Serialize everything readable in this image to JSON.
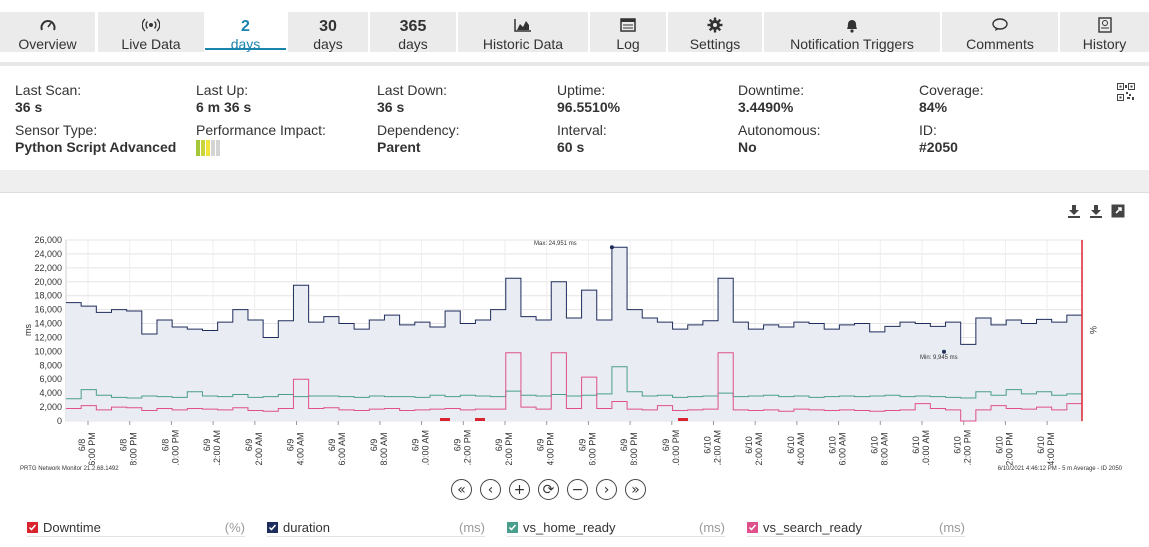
{
  "tabs": [
    {
      "label": "Overview",
      "icon": "gauge-icon"
    },
    {
      "label": "Live Data",
      "icon": "broadcast-icon"
    },
    {
      "big": "2",
      "label": "days",
      "selected": true
    },
    {
      "big": "30",
      "label": "days"
    },
    {
      "big": "365",
      "label": "days"
    },
    {
      "label": "Historic Data",
      "icon": "area-chart-icon"
    },
    {
      "label": "Log",
      "icon": "list-icon"
    },
    {
      "label": "Settings",
      "icon": "gear-icon"
    },
    {
      "label": "Notification Triggers",
      "icon": "bell-icon"
    },
    {
      "label": "Comments",
      "icon": "comment-icon"
    },
    {
      "label": "History",
      "icon": "history-icon"
    }
  ],
  "info": {
    "last_scan": {
      "label": "Last Scan:",
      "value": "36 s"
    },
    "last_up": {
      "label": "Last Up:",
      "value": "6 m 36 s"
    },
    "last_down": {
      "label": "Last Down:",
      "value": "36 s"
    },
    "uptime": {
      "label": "Uptime:",
      "value": "96.5510%"
    },
    "downtime": {
      "label": "Downtime:",
      "value": "3.4490%"
    },
    "coverage": {
      "label": "Coverage:",
      "value": "84%"
    },
    "sensor_type": {
      "label": "Sensor Type:",
      "value": "Python Script Advanced"
    },
    "performance_impact": {
      "label": "Performance Impact:",
      "level": 3,
      "of": 5
    },
    "dependency": {
      "label": "Dependency:",
      "value": "Parent"
    },
    "interval": {
      "label": "Interval:",
      "value": "60 s"
    },
    "autonomous": {
      "label": "Autonomous:",
      "value": "No"
    },
    "id": {
      "label": "ID:",
      "value": "#2050"
    }
  },
  "chart_data": {
    "type": "line",
    "ylabel_left": "ms",
    "ylabel_right": "%",
    "y_ticks": [
      "26,000",
      "24,000",
      "22,000",
      "20,000",
      "18,000",
      "16,000",
      "14,000",
      "12,000",
      "10,000",
      "8,000",
      "6,000",
      "4,000",
      "2,000",
      "0"
    ],
    "ylim": [
      0,
      26000
    ],
    "x_ticks": [
      [
        "6/8",
        "6:00 PM"
      ],
      [
        "6/8",
        "8:00 PM"
      ],
      [
        "6/8",
        "10:00 PM"
      ],
      [
        "6/9",
        "12:00 AM"
      ],
      [
        "6/9",
        "2:00 AM"
      ],
      [
        "6/9",
        "4:00 AM"
      ],
      [
        "6/9",
        "6:00 AM"
      ],
      [
        "6/9",
        "8:00 AM"
      ],
      [
        "6/9",
        "10:00 AM"
      ],
      [
        "6/9",
        "12:00 PM"
      ],
      [
        "6/9",
        "2:00 PM"
      ],
      [
        "6/9",
        "4:00 PM"
      ],
      [
        "6/9",
        "6:00 PM"
      ],
      [
        "6/9",
        "8:00 PM"
      ],
      [
        "6/9",
        "10:00 PM"
      ],
      [
        "6/10",
        "12:00 AM"
      ],
      [
        "6/10",
        "2:00 AM"
      ],
      [
        "6/10",
        "4:00 AM"
      ],
      [
        "6/10",
        "6:00 AM"
      ],
      [
        "6/10",
        "8:00 AM"
      ],
      [
        "6/10",
        "10:00 AM"
      ],
      [
        "6/10",
        "12:00 PM"
      ],
      [
        "6/10",
        "2:00 PM"
      ],
      [
        "6/10",
        "4:00 PM"
      ]
    ],
    "annotations": {
      "max": "Max: 24,951 ms",
      "min": "Min: 9,945 ms"
    },
    "series": [
      {
        "name": "duration",
        "color": "#1f2d5c",
        "values": [
          17000,
          16500,
          15600,
          16000,
          15800,
          12500,
          14500,
          13500,
          13200,
          13000,
          14200,
          16000,
          14500,
          12000,
          14400,
          19500,
          14200,
          15000,
          14000,
          13200,
          14500,
          15200,
          13800,
          14200,
          13500,
          15800,
          14000,
          14500,
          16000,
          20500,
          15000,
          14500,
          20000,
          14800,
          18800,
          14500,
          24951,
          16000,
          14800,
          14200,
          13200,
          13800,
          14400,
          20500,
          14200,
          13200,
          13800,
          13500,
          14200,
          14000,
          13200,
          13800,
          14000,
          12800,
          13600,
          14200,
          14000,
          13600,
          14200,
          11000,
          14800,
          13800,
          14500,
          14000,
          14600,
          14200,
          15200,
          15000
        ]
      },
      {
        "name": "vs_home_ready",
        "color": "#4a9f8c",
        "values": [
          3200,
          4500,
          3700,
          3400,
          3300,
          3600,
          3500,
          3400,
          4200,
          3600,
          3500,
          3800,
          3400,
          3500,
          3800,
          3500,
          3600,
          3600,
          3500,
          3400,
          3600,
          3500,
          3500,
          3400,
          3700,
          3500,
          3700,
          3600,
          3500,
          4300,
          3700,
          3600,
          3800,
          3600,
          3700,
          3900,
          7800,
          4200,
          3600,
          3700,
          3400,
          3500,
          3600,
          4000,
          3500,
          3600,
          3700,
          3500,
          3600,
          3400,
          3500,
          3600,
          3500,
          3600,
          3700,
          3500,
          3600,
          3500,
          3400,
          3300,
          4200,
          3700,
          4500,
          3900,
          4200,
          3700,
          3900,
          3900
        ]
      },
      {
        "name": "vs_search_ready",
        "color": "#e0508a",
        "values": [
          1800,
          2200,
          1600,
          2000,
          1900,
          1500,
          1800,
          1600,
          1800,
          1700,
          1600,
          1900,
          1500,
          1400,
          1800,
          6000,
          1800,
          1900,
          1600,
          1500,
          1700,
          1800,
          1500,
          1600,
          1700,
          1800,
          1600,
          1700,
          1700,
          9800,
          2000,
          1700,
          9800,
          1800,
          6300,
          1800,
          2800,
          1700,
          1600,
          2200,
          1500,
          1600,
          1700,
          9800,
          1600,
          1500,
          1600,
          1400,
          1700,
          1600,
          1500,
          1600,
          1500,
          1400,
          1500,
          1600,
          2500,
          1800,
          1600,
          0,
          1600,
          2200,
          1800,
          1700,
          2000,
          1600,
          2500,
          2200
        ]
      }
    ]
  },
  "footer": {
    "version": "PRTG Network Monitor 21.2.68.1492",
    "summary": "6/10/2021 4:46:12 PM - 5 m Average - ID 2050"
  },
  "nav_buttons": [
    {
      "icon": "double-chevron-left-icon",
      "glyph": "«"
    },
    {
      "icon": "chevron-left-icon",
      "glyph": "‹"
    },
    {
      "icon": "zoom-in-icon",
      "glyph": "+"
    },
    {
      "icon": "reset-zoom-icon",
      "glyph": "⟳"
    },
    {
      "icon": "zoom-out-icon",
      "glyph": "−"
    },
    {
      "icon": "chevron-right-icon",
      "glyph": "›"
    },
    {
      "icon": "double-chevron-right-icon",
      "glyph": "»"
    }
  ],
  "legend": [
    {
      "name": "Downtime",
      "unit": "(%)",
      "color": "#d9232e",
      "checked": true
    },
    {
      "name": "duration",
      "unit": "(ms)",
      "color": "#1f2d5c",
      "checked": true
    },
    {
      "name": "vs_home_ready",
      "unit": "(ms)",
      "color": "#4a9f8c",
      "checked": true
    },
    {
      "name": "vs_search_ready",
      "unit": "(ms)",
      "color": "#e0508a",
      "checked": true
    }
  ],
  "colors": {
    "accent": "#1a84ad",
    "downtime": "#d9232e"
  }
}
